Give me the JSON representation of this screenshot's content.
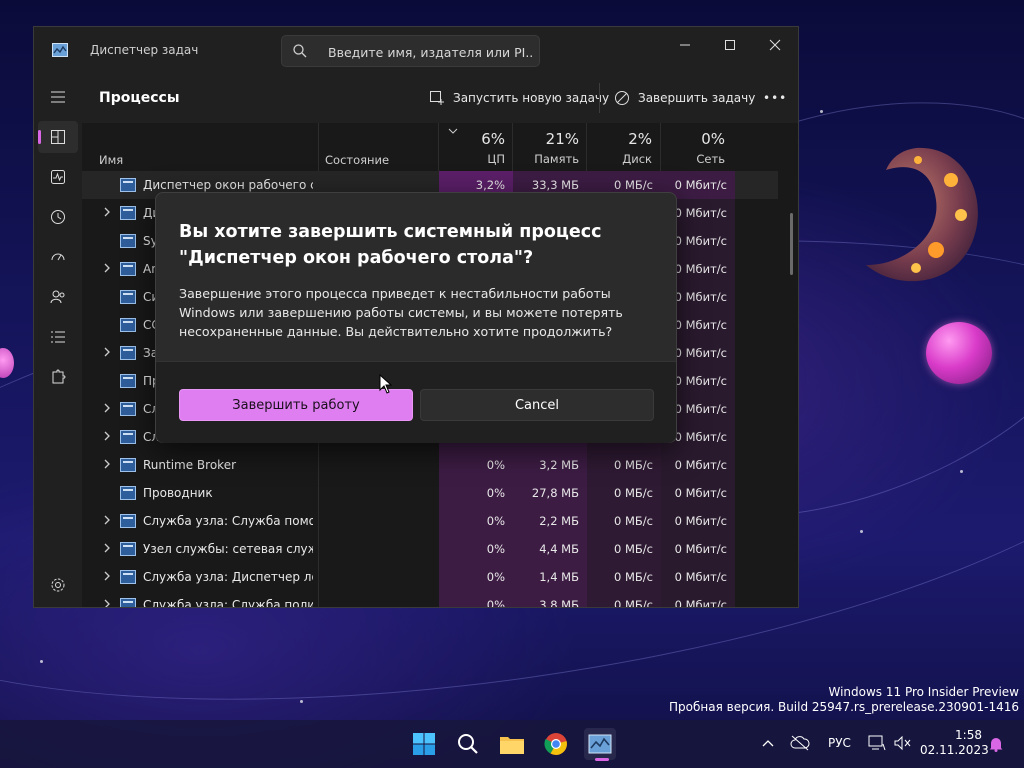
{
  "window": {
    "app_title": "Диспетчер задач",
    "search_placeholder": "Введите имя, издателя или PI...",
    "page_title": "Процессы",
    "run_new_task": "Запустить новую задачу",
    "end_task": "Завершить задачу",
    "more": "•••"
  },
  "sidebar": {
    "items": [
      "processes-icon",
      "performance-icon",
      "app-history-icon",
      "startup-apps-icon",
      "users-icon",
      "details-icon",
      "services-icon"
    ],
    "settings": "settings-icon"
  },
  "table": {
    "columns": {
      "name": "Имя",
      "state": "Состояние",
      "cpu": {
        "pct": "6%",
        "label": "ЦП"
      },
      "memory": {
        "pct": "21%",
        "label": "Память"
      },
      "disk": {
        "pct": "2%",
        "label": "Диск"
      },
      "network": {
        "pct": "0%",
        "label": "Сеть"
      }
    },
    "rows": [
      {
        "name": "Диспетчер окон рабочего ст...",
        "expandable": false,
        "cpu": "3,2%",
        "mem": "33,3 МБ",
        "disk": "0 МБ/с",
        "net": "0 Мбит/с"
      },
      {
        "name": "Ди",
        "expandable": true,
        "cpu": "",
        "mem": "",
        "disk": "",
        "net": "0 Мбит/с"
      },
      {
        "name": "Sy",
        "expandable": false,
        "cpu": "",
        "mem": "",
        "disk": "",
        "net": "0 Мбит/с"
      },
      {
        "name": "An",
        "expandable": true,
        "cpu": "",
        "mem": "",
        "disk": "",
        "net": "0 Мбит/с"
      },
      {
        "name": "Си",
        "expandable": false,
        "cpu": "",
        "mem": "",
        "disk": "",
        "net": "0 Мбит/с"
      },
      {
        "name": "CC",
        "expandable": false,
        "cpu": "",
        "mem": "",
        "disk": "",
        "net": "0 Мбит/с"
      },
      {
        "name": "За",
        "expandable": true,
        "cpu": "",
        "mem": "",
        "disk": "",
        "net": "0 Мбит/с"
      },
      {
        "name": "Пр",
        "expandable": false,
        "cpu": "",
        "mem": "",
        "disk": "",
        "net": "0 Мбит/с"
      },
      {
        "name": "Сл",
        "expandable": true,
        "cpu": "",
        "mem": "",
        "disk": "",
        "net": "0 Мбит/с"
      },
      {
        "name": "Сл",
        "expandable": true,
        "cpu": "",
        "mem": "",
        "disk": "",
        "net": "0 Мбит/с"
      },
      {
        "name": "Runtime Broker",
        "expandable": true,
        "cpu": "0%",
        "mem": "3,2 МБ",
        "disk": "0 МБ/с",
        "net": "0 Мбит/с"
      },
      {
        "name": "Проводник",
        "expandable": false,
        "cpu": "0%",
        "mem": "27,8 МБ",
        "disk": "0 МБ/с",
        "net": "0 Мбит/с"
      },
      {
        "name": "Служба узла: Служба помо...",
        "expandable": true,
        "cpu": "0%",
        "mem": "2,2 МБ",
        "disk": "0 МБ/с",
        "net": "0 Мбит/с"
      },
      {
        "name": "Узел службы: сетевая служба",
        "expandable": true,
        "cpu": "0%",
        "mem": "4,4 МБ",
        "disk": "0 МБ/с",
        "net": "0 Мбит/с"
      },
      {
        "name": "Служба узла: Диспетчер лок...",
        "expandable": true,
        "cpu": "0%",
        "mem": "1,4 МБ",
        "disk": "0 МБ/с",
        "net": "0 Мбит/с"
      },
      {
        "name": "Служба узла: Служба полит...",
        "expandable": true,
        "cpu": "0%",
        "mem": "3,8 МБ",
        "disk": "0 МБ/с",
        "net": "0 Мбит/с"
      }
    ]
  },
  "dialog": {
    "title": "Вы хотите завершить системный процесс \"Диспетчер окон рабочего стола\"?",
    "body": "Завершение этого процесса приведет к нестабильности работы Windows или завершению работы системы, и вы можете потерять несохраненные данные. Вы действительно хотите продолжить?",
    "confirm": "Завершить работу",
    "cancel": "Cancel"
  },
  "watermark": {
    "line1": "Windows 11 Pro Insider Preview",
    "line2": "Пробная версия. Build 25947.rs_prerelease.230901-1416"
  },
  "taskbar": {
    "lang": "РУС",
    "time": "1:58",
    "date": "02.11.2023"
  },
  "colors": {
    "accent": "#de7ef0",
    "heat_column": "#3d1c44",
    "window_bg": "#202020"
  }
}
